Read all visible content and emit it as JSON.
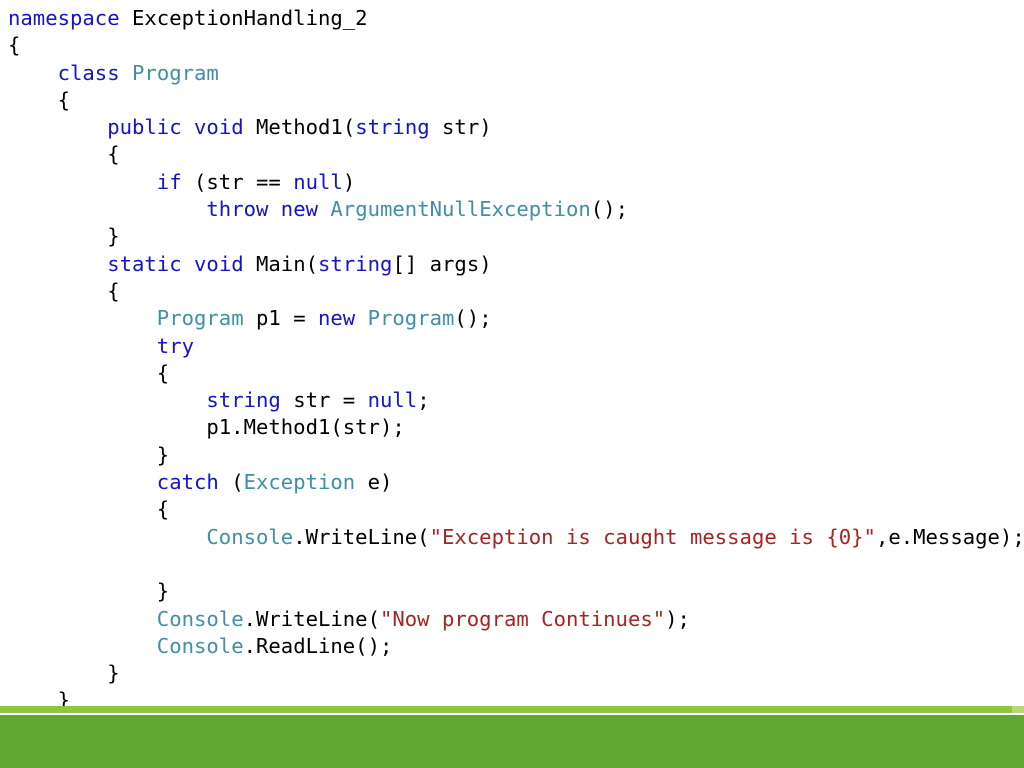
{
  "slide": {
    "kind": "code-listing-slide",
    "language": "C#",
    "background_color": "#ffffff",
    "decoration": {
      "light_band_color": "#8dc63f",
      "light_band_cap_color": "#b5d97a",
      "dark_band_color": "#60a832",
      "separator_color": "#ffffff"
    },
    "syntax_colors": {
      "keyword": "#1414c8",
      "type": "#3f90a3",
      "string": "#a52424",
      "plain": "#000000"
    }
  },
  "code": {
    "lines": [
      {
        "id": "line-01",
        "text": "namespace ExceptionHandling_2",
        "tokens": [
          {
            "t": "namespace",
            "c": "kw"
          },
          {
            "t": " ExceptionHandling_2",
            "c": "pl"
          }
        ]
      },
      {
        "id": "line-02",
        "text": "{",
        "tokens": [
          {
            "t": "{",
            "c": "pl"
          }
        ]
      },
      {
        "id": "line-03",
        "text": "    class Program",
        "tokens": [
          {
            "t": "    ",
            "c": "pl"
          },
          {
            "t": "class",
            "c": "kw"
          },
          {
            "t": " ",
            "c": "pl"
          },
          {
            "t": "Program",
            "c": "type"
          }
        ]
      },
      {
        "id": "line-04",
        "text": "    {",
        "tokens": [
          {
            "t": "    {",
            "c": "pl"
          }
        ]
      },
      {
        "id": "line-05",
        "text": "        public void Method1(string str)",
        "tokens": [
          {
            "t": "        ",
            "c": "pl"
          },
          {
            "t": "public",
            "c": "kw"
          },
          {
            "t": " ",
            "c": "pl"
          },
          {
            "t": "void",
            "c": "kw"
          },
          {
            "t": " Method1(",
            "c": "pl"
          },
          {
            "t": "string",
            "c": "kw"
          },
          {
            "t": " str)",
            "c": "pl"
          }
        ]
      },
      {
        "id": "line-06",
        "text": "        {",
        "tokens": [
          {
            "t": "        {",
            "c": "pl"
          }
        ]
      },
      {
        "id": "line-07",
        "text": "            if (str == null)",
        "tokens": [
          {
            "t": "            ",
            "c": "pl"
          },
          {
            "t": "if",
            "c": "kw"
          },
          {
            "t": " (str == ",
            "c": "pl"
          },
          {
            "t": "null",
            "c": "kw"
          },
          {
            "t": ")",
            "c": "pl"
          }
        ]
      },
      {
        "id": "line-08",
        "text": "                throw new ArgumentNullException();",
        "tokens": [
          {
            "t": "                ",
            "c": "pl"
          },
          {
            "t": "throw",
            "c": "kw"
          },
          {
            "t": " ",
            "c": "pl"
          },
          {
            "t": "new",
            "c": "kw"
          },
          {
            "t": " ",
            "c": "pl"
          },
          {
            "t": "ArgumentNullException",
            "c": "type"
          },
          {
            "t": "();",
            "c": "pl"
          }
        ]
      },
      {
        "id": "line-09",
        "text": "        }",
        "tokens": [
          {
            "t": "        }",
            "c": "pl"
          }
        ]
      },
      {
        "id": "line-10",
        "text": "        static void Main(string[] args)",
        "tokens": [
          {
            "t": "        ",
            "c": "pl"
          },
          {
            "t": "static",
            "c": "kw"
          },
          {
            "t": " ",
            "c": "pl"
          },
          {
            "t": "void",
            "c": "kw"
          },
          {
            "t": " Main(",
            "c": "pl"
          },
          {
            "t": "string",
            "c": "kw"
          },
          {
            "t": "[] args)",
            "c": "pl"
          }
        ]
      },
      {
        "id": "line-11",
        "text": "        {",
        "tokens": [
          {
            "t": "        {",
            "c": "pl"
          }
        ]
      },
      {
        "id": "line-12",
        "text": "            Program p1 = new Program();",
        "tokens": [
          {
            "t": "            ",
            "c": "pl"
          },
          {
            "t": "Program",
            "c": "type"
          },
          {
            "t": " p1 = ",
            "c": "pl"
          },
          {
            "t": "new",
            "c": "kw"
          },
          {
            "t": " ",
            "c": "pl"
          },
          {
            "t": "Program",
            "c": "type"
          },
          {
            "t": "();",
            "c": "pl"
          }
        ]
      },
      {
        "id": "line-13",
        "text": "            try",
        "tokens": [
          {
            "t": "            ",
            "c": "pl"
          },
          {
            "t": "try",
            "c": "kw"
          }
        ]
      },
      {
        "id": "line-14",
        "text": "            {",
        "tokens": [
          {
            "t": "            {",
            "c": "pl"
          }
        ]
      },
      {
        "id": "line-15",
        "text": "                string str = null;",
        "tokens": [
          {
            "t": "                ",
            "c": "pl"
          },
          {
            "t": "string",
            "c": "kw"
          },
          {
            "t": " str = ",
            "c": "pl"
          },
          {
            "t": "null",
            "c": "kw"
          },
          {
            "t": ";",
            "c": "pl"
          }
        ]
      },
      {
        "id": "line-16",
        "text": "                p1.Method1(str);",
        "tokens": [
          {
            "t": "                p1.Method1(str);",
            "c": "pl"
          }
        ]
      },
      {
        "id": "line-17",
        "text": "            }",
        "tokens": [
          {
            "t": "            }",
            "c": "pl"
          }
        ]
      },
      {
        "id": "line-18",
        "text": "            catch (Exception e)",
        "tokens": [
          {
            "t": "            ",
            "c": "pl"
          },
          {
            "t": "catch",
            "c": "kw"
          },
          {
            "t": " (",
            "c": "pl"
          },
          {
            "t": "Exception",
            "c": "type"
          },
          {
            "t": " e)",
            "c": "pl"
          }
        ]
      },
      {
        "id": "line-19",
        "text": "            {",
        "tokens": [
          {
            "t": "            {",
            "c": "pl"
          }
        ]
      },
      {
        "id": "line-20",
        "text": "                Console.WriteLine(\"Exception is caught message is {0}\",e.Message);",
        "tokens": [
          {
            "t": "                ",
            "c": "pl"
          },
          {
            "t": "Console",
            "c": "type"
          },
          {
            "t": ".WriteLine(",
            "c": "pl"
          },
          {
            "t": "\"Exception is caught message is {0}\"",
            "c": "str"
          },
          {
            "t": ",e.Message);",
            "c": "pl"
          }
        ]
      },
      {
        "id": "line-21",
        "text": "",
        "tokens": []
      },
      {
        "id": "line-22",
        "text": "            }",
        "tokens": [
          {
            "t": "            }",
            "c": "pl"
          }
        ]
      },
      {
        "id": "line-23",
        "text": "            Console.WriteLine(\"Now program Continues\");",
        "tokens": [
          {
            "t": "            ",
            "c": "pl"
          },
          {
            "t": "Console",
            "c": "type"
          },
          {
            "t": ".WriteLine(",
            "c": "pl"
          },
          {
            "t": "\"Now program Continues\"",
            "c": "str"
          },
          {
            "t": ");",
            "c": "pl"
          }
        ]
      },
      {
        "id": "line-24",
        "text": "            Console.ReadLine();",
        "tokens": [
          {
            "t": "            ",
            "c": "pl"
          },
          {
            "t": "Console",
            "c": "type"
          },
          {
            "t": ".ReadLine();",
            "c": "pl"
          }
        ]
      },
      {
        "id": "line-25",
        "text": "        }",
        "tokens": [
          {
            "t": "        }",
            "c": "pl"
          }
        ]
      },
      {
        "id": "line-26",
        "text": "    }",
        "tokens": [
          {
            "t": "    }",
            "c": "pl"
          }
        ]
      },
      {
        "id": "line-27",
        "text": "}",
        "tokens": [
          {
            "t": "}",
            "c": "pl"
          }
        ]
      }
    ]
  }
}
